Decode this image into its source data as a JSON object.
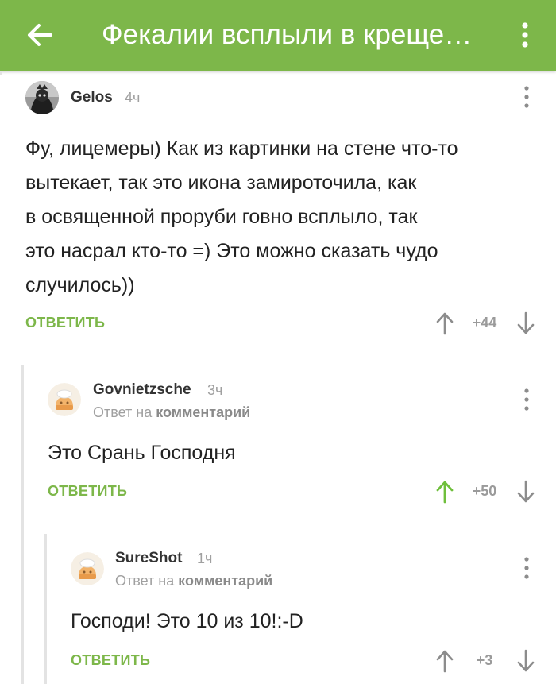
{
  "appbar": {
    "title": "Фекалии всплыли в креще…",
    "color": "#7db74a"
  },
  "comments": [
    {
      "author": "Gelos",
      "time": "4ч",
      "text_lines": [
        "Фу, лицемеры) Как из картинки на стене что-то",
        "вытекает, так это икона замироточила, как",
        "в освященной проруби говно всплыло, так",
        "это насрал кто-то =) Это можно сказать чудо",
        "случилось))"
      ],
      "reply_label": "ОТВЕТИТЬ",
      "score": "+44"
    },
    {
      "author": "Govnietzsche",
      "time": "3ч",
      "reply_prefix": "Ответ на",
      "reply_target": "комментарий",
      "text": "Это Срань Господня",
      "reply_label": "ОТВЕТИТЬ",
      "score": "+50"
    },
    {
      "author": "SureShot",
      "time": "1ч",
      "reply_prefix": "Ответ на",
      "reply_target": "комментарий",
      "text": "Господи! Это 10 из 10!:-D",
      "reply_label": "ОТВЕТИТЬ",
      "score": "+3"
    }
  ],
  "icons": {
    "back": "arrow-left-icon",
    "menu": "more-vertical-icon",
    "upvote": "arrow-up-icon",
    "downvote": "arrow-down-icon"
  },
  "colors": {
    "accent": "#7db74a",
    "upvoted": "#6fbf3c",
    "neutral_icon": "#8c8c8c"
  }
}
